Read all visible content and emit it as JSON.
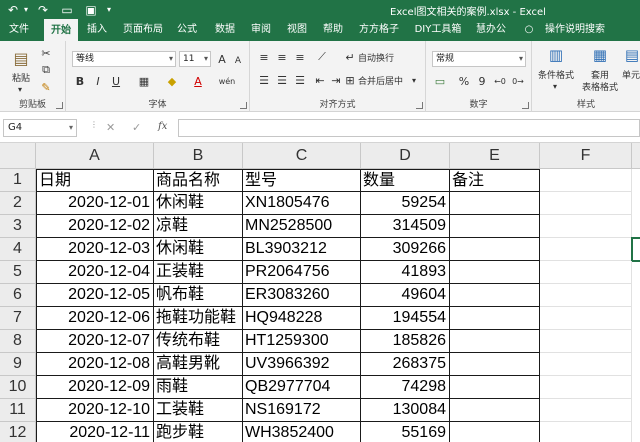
{
  "titlebar": {
    "title": "Excel图文相关的案例.xlsx  -  Excel",
    "undo": "↶",
    "redo": "↷",
    "open": "▭",
    "save": "▣",
    "more": "▾"
  },
  "tabs": [
    "文件",
    "开始",
    "插入",
    "页面布局",
    "公式",
    "数据",
    "审阅",
    "视图",
    "帮助",
    "方方格子",
    "DIY工具箱",
    "慧办公",
    "操作说明搜索"
  ],
  "active_tab": "开始",
  "ribbon": {
    "clipboard": {
      "label": "剪贴板",
      "paste": "粘贴"
    },
    "font": {
      "label": "字体",
      "font_name": "等线",
      "font_size": "11",
      "bold": "B",
      "italic": "I",
      "underline": "U",
      "grow": "A",
      "shrink": "A",
      "wen": "wén",
      "font_color": "A"
    },
    "alignment": {
      "label": "对齐方式",
      "wrap": "自动换行",
      "merge": "合并后居中"
    },
    "number": {
      "label": "数字",
      "format": "常规",
      "percent": "%",
      "comma": "9"
    },
    "styles": {
      "label": "样式",
      "cond_format": "条件格式",
      "table_format_1": "套用",
      "table_format_2": "表格格式",
      "cell_style": "单元"
    }
  },
  "formula_bar": {
    "name_box": "G4",
    "cancel": "✕",
    "enter": "✓",
    "fx": "fx",
    "value": ""
  },
  "columns": [
    "A",
    "B",
    "C",
    "D",
    "E",
    "F"
  ],
  "rows": [
    {
      "n": "1",
      "date": "日期",
      "name": "商品名称",
      "model": "型号",
      "qty": "数量",
      "note": "备注"
    },
    {
      "n": "2",
      "date": "2020-12-01",
      "name": "休闲鞋",
      "model": "XN1805476",
      "qty": "59254",
      "note": ""
    },
    {
      "n": "3",
      "date": "2020-12-02",
      "name": "凉鞋",
      "model": "MN2528500",
      "qty": "314509",
      "note": ""
    },
    {
      "n": "4",
      "date": "2020-12-03",
      "name": "休闲鞋",
      "model": "BL3903212",
      "qty": "309266",
      "note": ""
    },
    {
      "n": "5",
      "date": "2020-12-04",
      "name": "正装鞋",
      "model": "PR2064756",
      "qty": "41893",
      "note": ""
    },
    {
      "n": "6",
      "date": "2020-12-05",
      "name": "帆布鞋",
      "model": "ER3083260",
      "qty": "49604",
      "note": ""
    },
    {
      "n": "7",
      "date": "2020-12-06",
      "name": "拖鞋功能鞋",
      "model": "HQ948228",
      "qty": "194554",
      "note": ""
    },
    {
      "n": "8",
      "date": "2020-12-07",
      "name": "传统布鞋",
      "model": "HT1259300",
      "qty": "185826",
      "note": ""
    },
    {
      "n": "9",
      "date": "2020-12-08",
      "name": "高鞋男靴",
      "model": "UV3966392",
      "qty": "268375",
      "note": ""
    },
    {
      "n": "10",
      "date": "2020-12-09",
      "name": "雨鞋",
      "model": "QB2977704",
      "qty": "74298",
      "note": ""
    },
    {
      "n": "11",
      "date": "2020-12-10",
      "name": "工装鞋",
      "model": "NS169172",
      "qty": "130084",
      "note": ""
    },
    {
      "n": "12",
      "date": "2020-12-11",
      "name": "跑步鞋",
      "model": "WH3852400",
      "qty": "55169",
      "note": ""
    }
  ]
}
